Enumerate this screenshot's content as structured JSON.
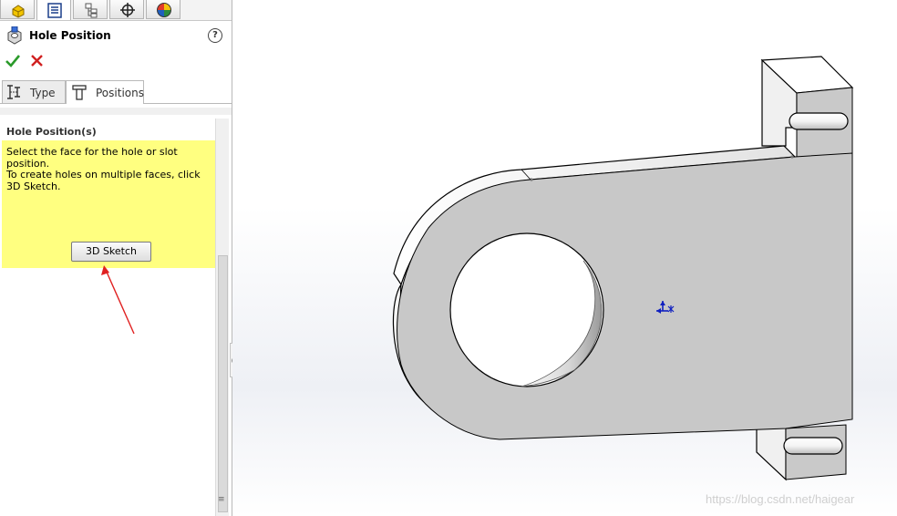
{
  "manager_tabs": [
    {
      "name": "FeatureManager",
      "icon": "part-icon"
    },
    {
      "name": "PropertyManager",
      "icon": "property-manager-icon",
      "active": true
    },
    {
      "name": "ConfigurationManager",
      "icon": "configuration-icon"
    },
    {
      "name": "DimXpertManager",
      "icon": "crosshair-icon"
    },
    {
      "name": "DisplayManager",
      "icon": "display-manager-icon"
    }
  ],
  "property_manager": {
    "title": "Hole Position",
    "help": "?",
    "ok_icon": "checkmark-icon",
    "cancel_icon": "cross-icon"
  },
  "tabs": {
    "type_label": "Type",
    "positions_label": "Positions",
    "active": "Positions"
  },
  "hole_position_group": {
    "title": "Hole Position(s)",
    "message_line1": "Select the face for the hole or slot position.",
    "message_line2": "To create holes on multiple faces, click 3D Sketch.",
    "button_label": "3D Sketch"
  },
  "colors": {
    "message_background": "#ffff80",
    "ok_green": "#2a9a2a",
    "cancel_red": "#d02020",
    "annotation_arrow": "#e02020",
    "part_face": "#c8c8c8",
    "part_edge": "#000000",
    "origin_blue": "#1020c0"
  },
  "viewport": {
    "watermark": "https://blog.csdn.net/haigear"
  }
}
